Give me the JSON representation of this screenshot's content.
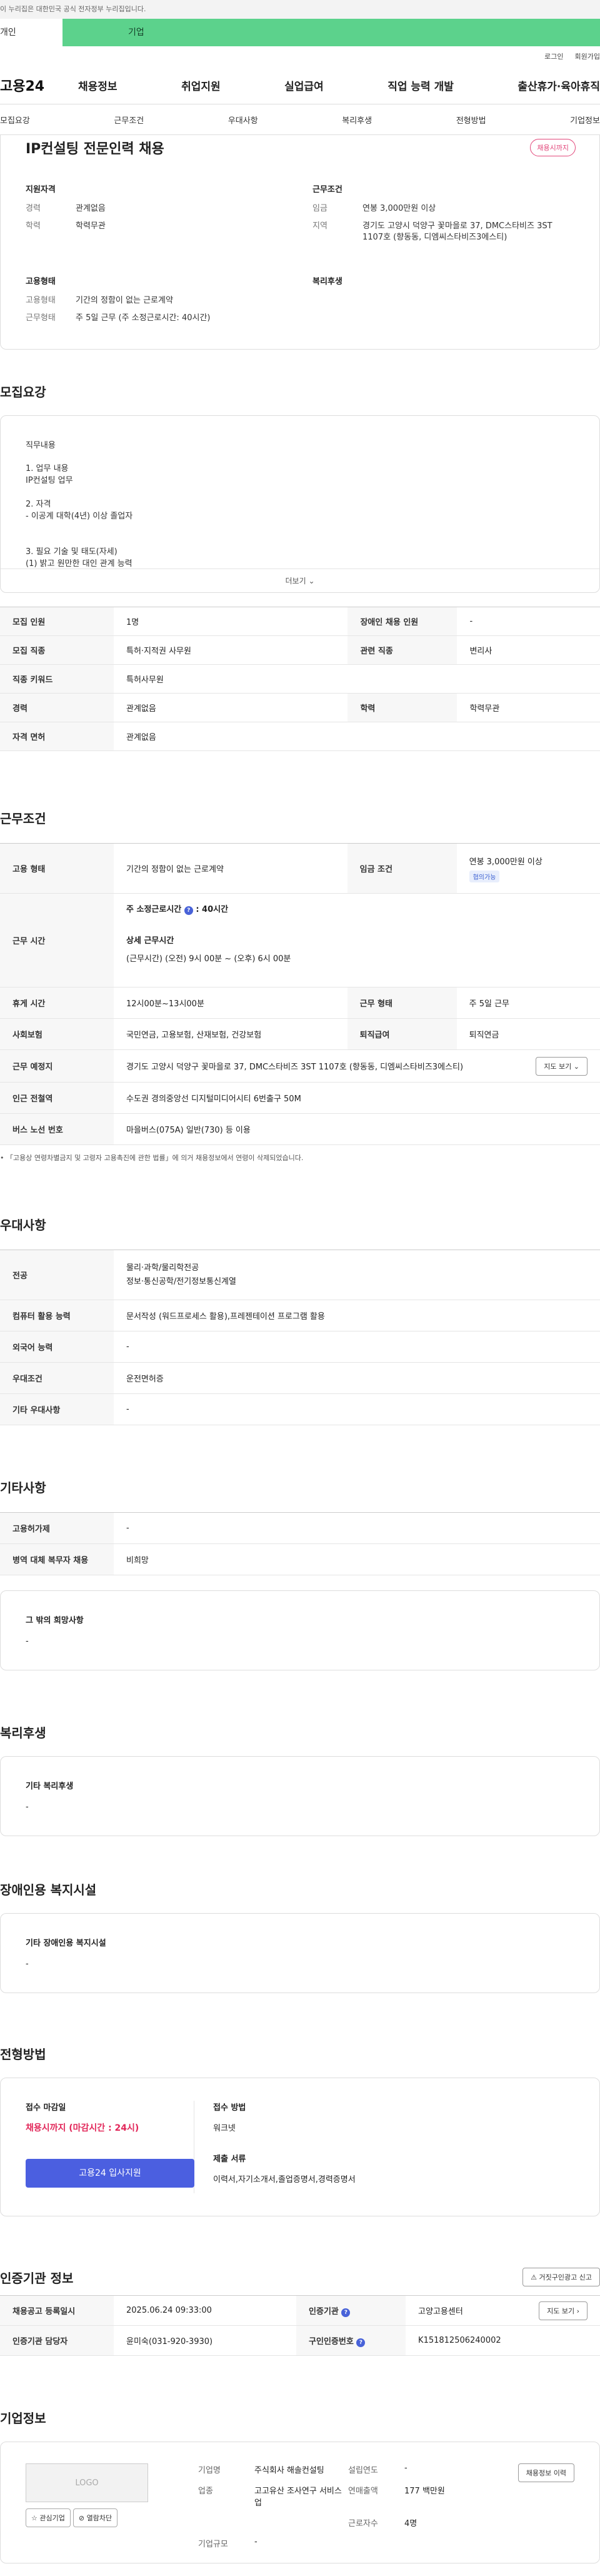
{
  "site": {
    "notice": "이 누리집은 대한민국 공식 전자정부 누리집입니다.",
    "tabs": [
      "개인",
      "기업"
    ],
    "util": [
      "로그인",
      "회원가입"
    ],
    "logo": "고용24",
    "menus": [
      "채용정보",
      "취업지원",
      "실업급여",
      "직업 능력 개발",
      "출산휴가·육아휴직"
    ],
    "subnav": [
      "모집요강",
      "근무조건",
      "우대사항",
      "복리후생",
      "전형방법",
      "기업정보"
    ]
  },
  "job": {
    "title": "IP컨설팅 전문인력 채용",
    "status": "채용시까지",
    "summary": {
      "qual_h": "지원자격",
      "qual": [
        {
          "k": "경력",
          "v": "관계없음"
        },
        {
          "k": "학력",
          "v": "학력무관"
        }
      ],
      "cond_h": "근무조건",
      "cond": [
        {
          "k": "임금",
          "v": "연봉 3,000만원 이상"
        },
        {
          "k": "지역",
          "v": "경기도 고양시 덕양구 꽃마을로 37, DMC스타비즈 3ST 1107호 (향동동, 디엠씨스타비즈3에스티)"
        }
      ],
      "emp_h": "고용형태",
      "emp": [
        {
          "k": "고용형태",
          "v": "기간의 정함이 없는 근로계약"
        },
        {
          "k": "근무형태",
          "v": "주 5일 근무 (주 소정근로시간: 40시간)"
        }
      ],
      "welfare_h": "복리후생"
    }
  },
  "recruit": {
    "title": "모집요강",
    "more_lines": [
      "직무내용",
      "",
      "1. 업무 내용",
      "IP컨설팅 업무",
      "",
      "2. 자격",
      "- 이공계 대학(4년) 이상 졸업자",
      "",
      "",
      "3. 필요 기술 및 태도(자세)",
      "(1) 밝고 원만한 대인 관계 능력"
    ],
    "more_btn": "더보기",
    "rows": [
      [
        {
          "k": "모집 인원",
          "v": "1명"
        },
        {
          "k": "장애인 채용 인원",
          "v": "-"
        }
      ],
      [
        {
          "k": "모집 직종",
          "v": "특허·지적권 사무원"
        },
        {
          "k": "관련 직종",
          "v": "변리사"
        }
      ],
      [
        {
          "k": "직종 키워드",
          "v": "특허사무원"
        }
      ],
      [
        {
          "k": "경력",
          "v": "관계없음"
        },
        {
          "k": "학력",
          "v": "학력무관"
        }
      ],
      [
        {
          "k": "자격 면허",
          "v": "관계없음"
        }
      ]
    ]
  },
  "work": {
    "title": "근무조건",
    "emp_k": "고용 형태",
    "emp_v": "기간의 정함이 없는 근로계약",
    "wage_k": "임금 조건",
    "wage_v": "연봉 3,000만원 이상",
    "wage_tag": "협의가능",
    "hours_k": "근무 시간",
    "hours_h1": "주 소정근로시간",
    "hours_v1": ": 40시간",
    "hours_h2": "상세 근무시간",
    "hours_v2": "(근무시간) (오전) 9시 00분 ~ (오후) 6시 00분",
    "break_k": "휴게 시간",
    "break_v": "12시00분~13시00분",
    "form_k": "근무 형태",
    "form_v": "주 5일 근무",
    "ins_k": "사회보험",
    "ins_v": "국민연금, 고용보험, 산재보험, 건강보험",
    "pension_k": "퇴직급여",
    "pension_v": "퇴직연금",
    "place_k": "근무 예정지",
    "place_v": "경기도 고양시 덕양구 꽃마을로 37, DMC스타비즈 3ST 1107호 (향동동, 디엠씨스타비즈3에스티)",
    "map_btn": "지도 보기",
    "subway_k": "인근 전철역",
    "subway_v": "수도권 경의중앙선 디지털미디어시티 6번출구 50M",
    "bus_k": "버스 노선 번호",
    "bus_v": "마을버스(075A) 일반(730) 등 이용",
    "note": "「고용상 연령차별금지 및 고령자 고용촉진에 관한 법률」에 의거 채용정보에서 연령이 삭제되었습니다."
  },
  "pref": {
    "title": "우대사항",
    "rows": [
      {
        "k": "전공",
        "v": [
          "물리·과학/물리학전공",
          "정보·통신공학/전기정보통신계열"
        ]
      },
      {
        "k": "컴퓨터 활용 능력",
        "v": [
          "문서작성 (워드프로세스 활용),프레젠테이션 프로그램 활용"
        ]
      },
      {
        "k": "외국어 능력",
        "v": [
          "-"
        ]
      },
      {
        "k": "우대조건",
        "v": [
          "운전면허증"
        ]
      },
      {
        "k": "기타 우대사항",
        "v": [
          "-"
        ]
      }
    ]
  },
  "etc": {
    "title": "기타사항",
    "rows": [
      {
        "k": "고용허가제",
        "v": "-"
      },
      {
        "k": "병역 대체 복무자 채용",
        "v": "비희망"
      }
    ],
    "box_h": "그 밖의 희망사항",
    "box_v": "-"
  },
  "welfare": {
    "title": "복리후생",
    "box_h": "기타 복리후생",
    "box_v": "-"
  },
  "disabled": {
    "title": "장애인용 복지시설",
    "box_h": "기타 장애인용 복지시설",
    "box_v": "-"
  },
  "apply": {
    "title": "전형방법",
    "deadline_h": "접수 마감일",
    "deadline_v": "채용시까지 (마감시간 : 24시)",
    "apply_btn": "고용24 입사지원",
    "method_h": "접수 방법",
    "method_v": "워크넷",
    "docs_h": "제출 서류",
    "docs_v": "이력서,자기소개서,졸업증명서,경력증명서"
  },
  "cert": {
    "title": "인증기관 정보",
    "report_btn": "거짓구인광고 신고",
    "rows": [
      [
        {
          "k": "채용공고 등록일시",
          "v": "2025.06.24 09:33:00"
        },
        {
          "k": "인증기관",
          "v": "고양고용센터",
          "btn": "지도 보기"
        }
      ],
      [
        {
          "k": "인증기관 담당자",
          "v": "윤미숙(031-920-3930)"
        },
        {
          "k": "구인인증번호",
          "v": "K151812506240002"
        }
      ]
    ]
  },
  "company": {
    "title": "기업정보",
    "logo": "LOGO",
    "fav_btn": "관심기업",
    "block_btn": "열람차단",
    "info": [
      {
        "k": "기업명",
        "v": "주식회사 해솔컨설팅"
      },
      {
        "k": "설립연도",
        "v": "-"
      },
      {
        "k": "업종",
        "v": "고고유산 조사연구 서비스업"
      },
      {
        "k": "연매출액",
        "v": "177 백만원"
      },
      {
        "k": "",
        "v": ""
      },
      {
        "k": "근로자수",
        "v": "4명"
      },
      {
        "k": "기업규모",
        "v": "-"
      }
    ],
    "history_btn": "채용정보 이력"
  }
}
